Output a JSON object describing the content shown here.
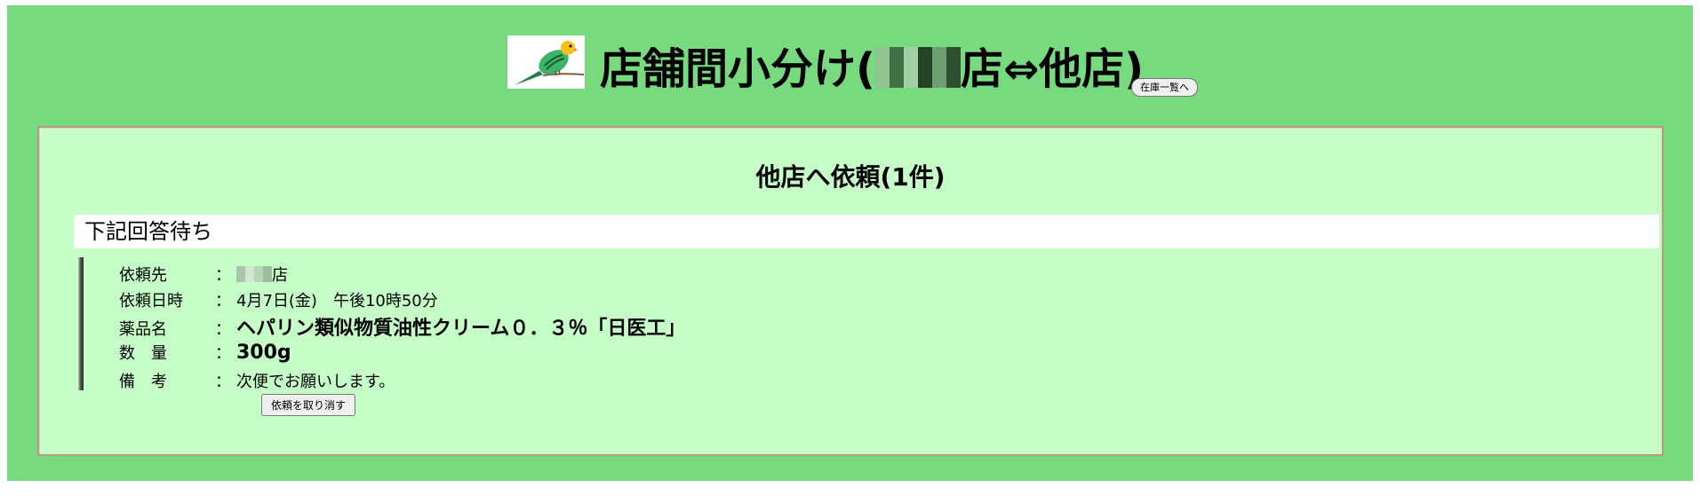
{
  "header": {
    "title_prefix": "店舗間小分け(",
    "title_suffix": "店⇔他店)",
    "inventory_button_label": "在庫一覧へ",
    "logo_icon": "budgerigar-icon"
  },
  "panel": {
    "title": "他店へ依頼(1件)",
    "status_label": "下記回答待ち",
    "request": {
      "destination": {
        "label": "依頼先",
        "colon": "：",
        "value_suffix": "店"
      },
      "datetime": {
        "label": "依頼日時",
        "colon": "：",
        "value": "4月7日(金)　午後10時50分"
      },
      "drug": {
        "label": "薬品名",
        "colon": "：",
        "value": "ヘパリン類似物質油性クリーム０．３％「日医工」"
      },
      "quantity": {
        "label": "数　量",
        "colon": "：",
        "value": "300g"
      },
      "remarks": {
        "label": "備　考",
        "colon": "：",
        "value": "次便でお願いします。"
      }
    },
    "cancel_button_label": "依頼を取り消す"
  },
  "colors": {
    "outer_background": "#78da7f",
    "panel_background": "#c5fec6",
    "panel_border": "#b99a7e"
  }
}
